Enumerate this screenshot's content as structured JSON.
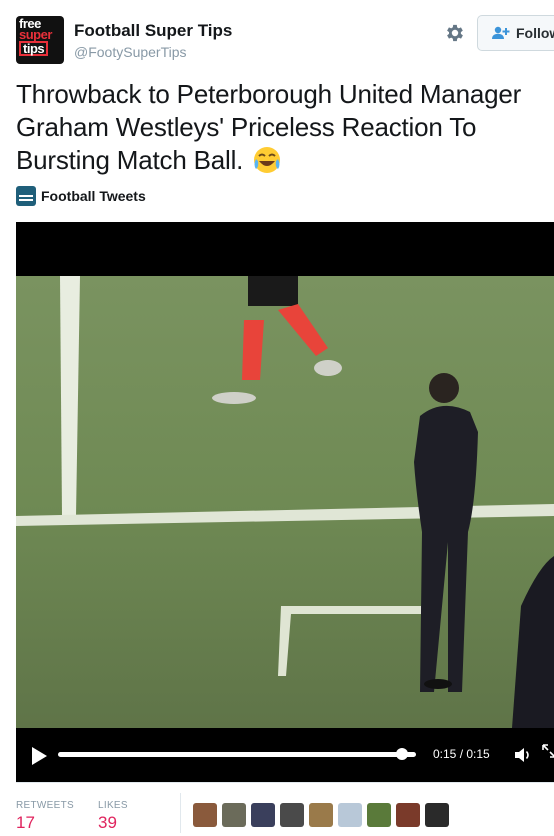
{
  "author": {
    "name": "Football Super Tips",
    "handle": "@FootySuperTips",
    "avatar_text": [
      "free",
      "super",
      "tips"
    ]
  },
  "actions": {
    "follow_label": "Follow",
    "settings_icon": "gear-icon",
    "follow_icon": "add-user-icon"
  },
  "tweet": {
    "text": "Throwback to Peterborough United Manager Graham Westleys' Priceless Reaction To Bursting Match Ball.",
    "emoji": "face-with-tears-of-joy"
  },
  "source": {
    "label": "Football Tweets"
  },
  "video": {
    "time_display": "0:15 / 0:15",
    "progress": 1.0,
    "play_icon": "play-icon",
    "volume_icon": "volume-icon",
    "fullscreen_icon": "expand-icon"
  },
  "stats": {
    "retweets_label": "RETWEETS",
    "retweets_value": "17",
    "likes_label": "LIKES",
    "likes_value": "39"
  },
  "likers": [
    {
      "color": "#8a5a3c"
    },
    {
      "color": "#6b6b5a"
    },
    {
      "color": "#3a3f5c"
    },
    {
      "color": "#4a4a4a"
    },
    {
      "color": "#9a7a4a"
    },
    {
      "color": "#b8c8d8"
    },
    {
      "color": "#5a7a3a"
    },
    {
      "color": "#7a3a2a"
    },
    {
      "color": "#2a2a2a"
    }
  ],
  "colors": {
    "accent_like": "#e0245e",
    "muted": "#8899a6",
    "pitch": "#6f8a54"
  }
}
